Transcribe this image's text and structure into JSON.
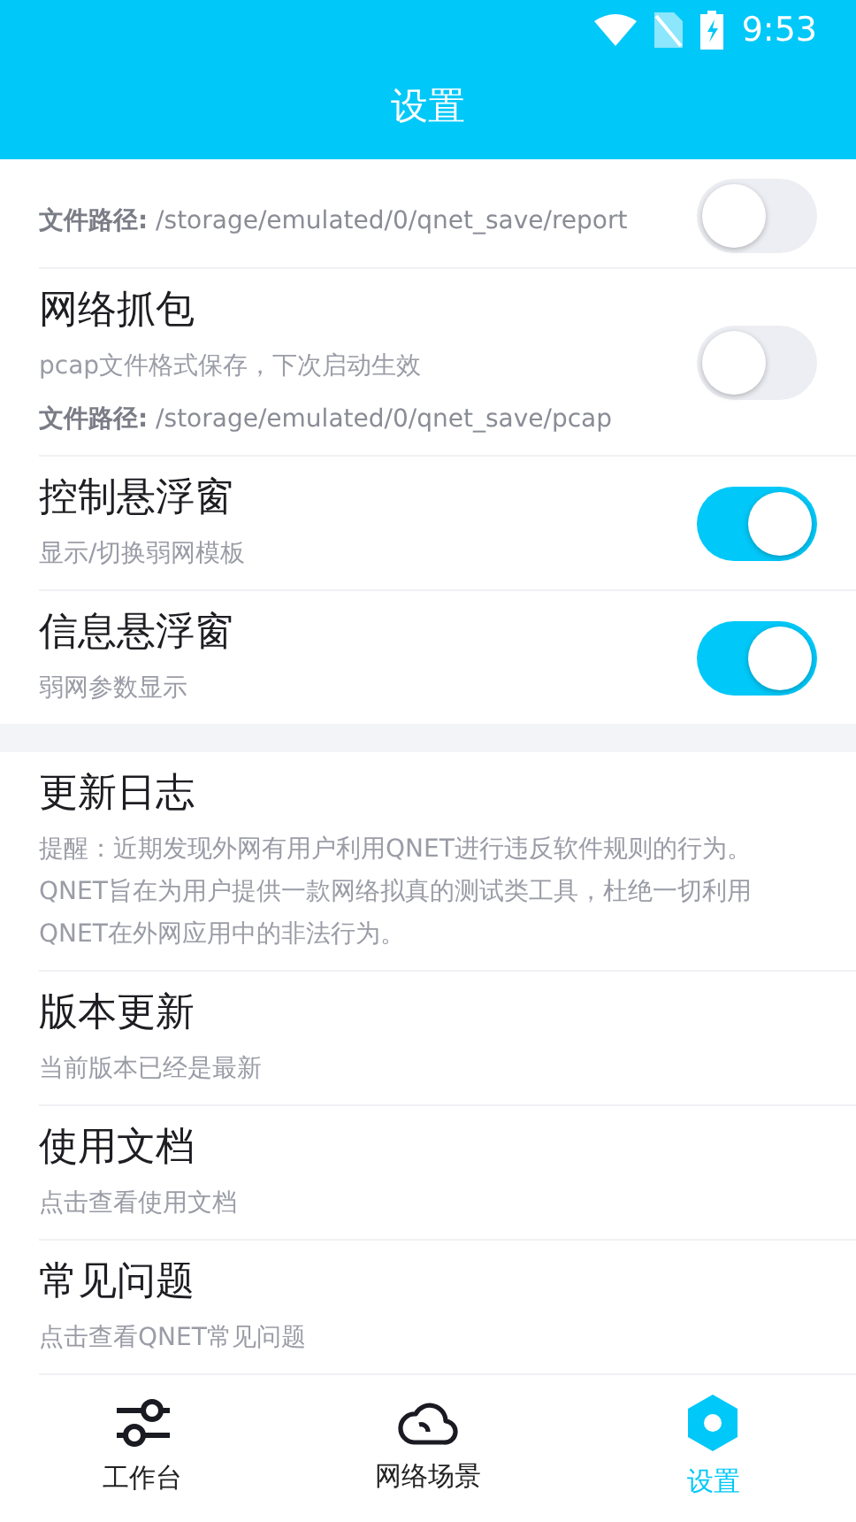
{
  "status_bar": {
    "time": "9:53"
  },
  "header": {
    "title": "设置"
  },
  "sections": [
    {
      "items": [
        {
          "kind": "toggle",
          "path": "**文件路径:** /storage/emulated/0/qnet_save/report",
          "on": false
        },
        {
          "kind": "toggle",
          "title": "网络抓包",
          "subtitle": "pcap文件格式保存，下次启动生效",
          "path": "**文件路径:** /storage/emulated/0/qnet_save/pcap",
          "on": false
        },
        {
          "kind": "toggle",
          "title": "控制悬浮窗",
          "subtitle": "显示/切换弱网模板",
          "on": true
        },
        {
          "kind": "toggle",
          "title": "信息悬浮窗",
          "subtitle": "弱网参数显示",
          "on": true
        }
      ]
    },
    {
      "items": [
        {
          "kind": "link",
          "title": "更新日志",
          "subtitle": "提醒：近期发现外网有用户利用QNET进行违反软件规则的行为。QNET旨在为用户提供一款网络拟真的测试类工具，杜绝一切利用QNET在外网应用中的非法行为。"
        },
        {
          "kind": "link",
          "title": "版本更新",
          "subtitle": "当前版本已经是最新"
        },
        {
          "kind": "link",
          "title": "使用文档",
          "subtitle": "点击查看使用文档"
        },
        {
          "kind": "link",
          "title": "常见问题",
          "subtitle": "点击查看QNET常见问题"
        }
      ]
    }
  ],
  "nav": [
    {
      "label": "工作台",
      "selected": false
    },
    {
      "label": "网络场景",
      "selected": false
    },
    {
      "label": "设置",
      "selected": true
    }
  ]
}
